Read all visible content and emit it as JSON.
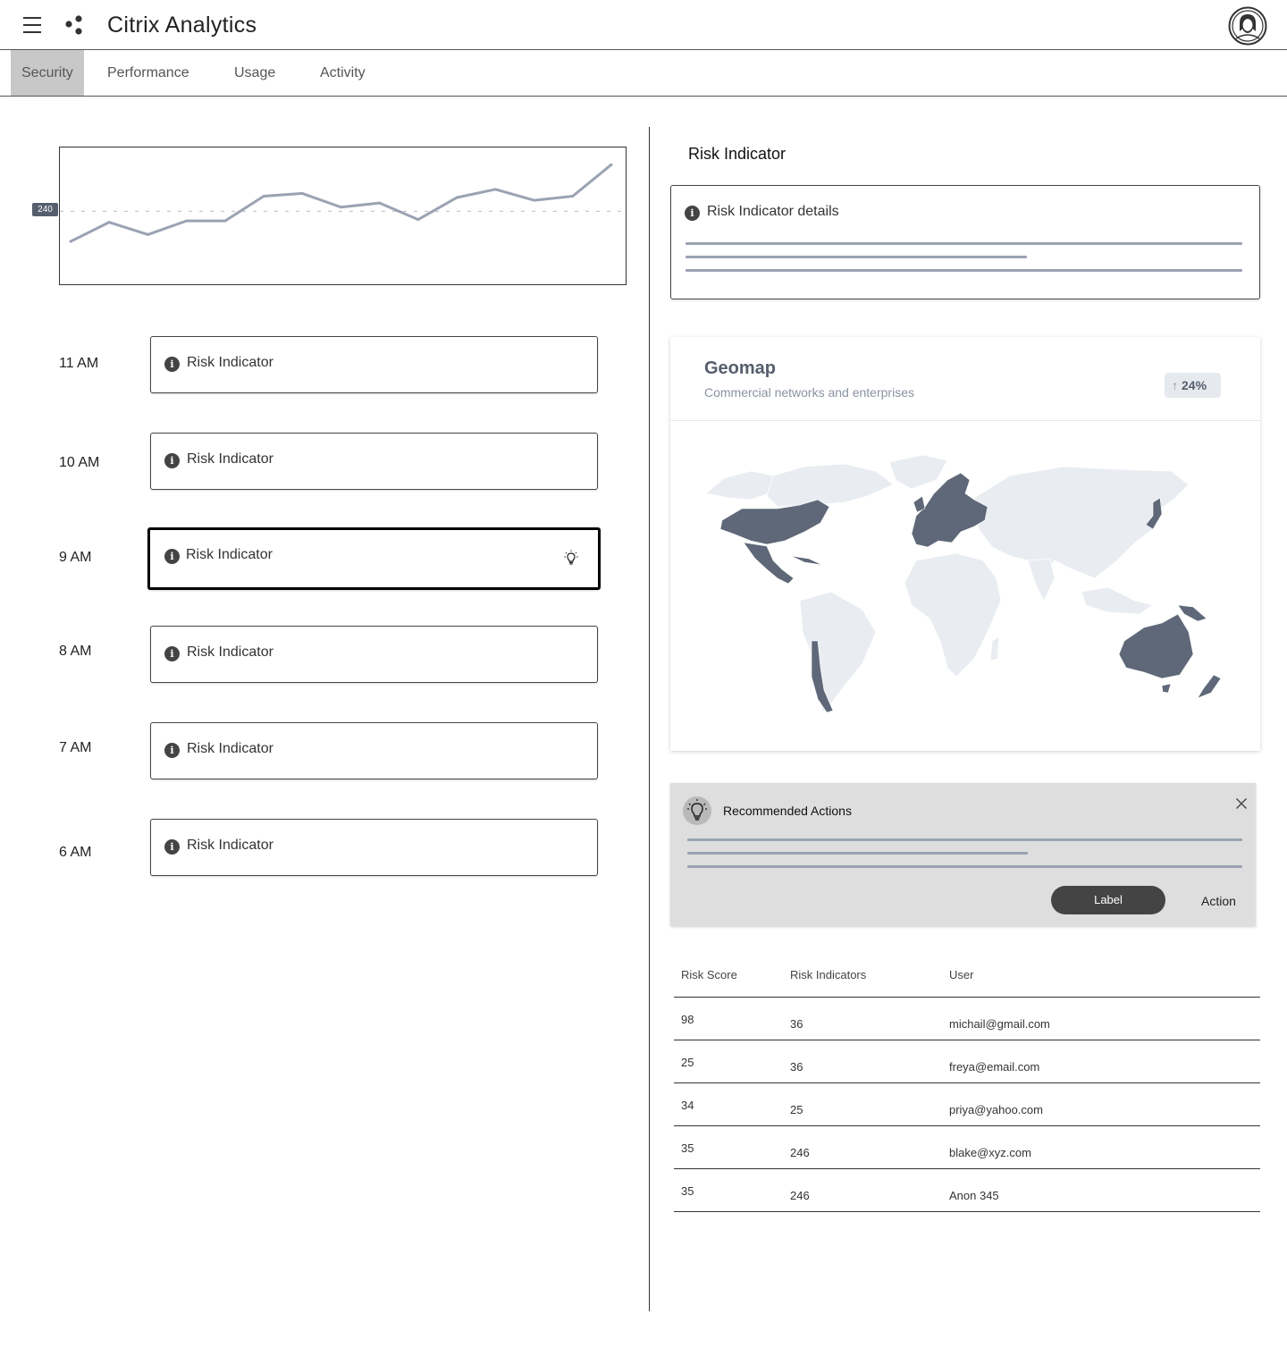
{
  "app": {
    "title": "Citrix Analytics"
  },
  "icons": {
    "menu": "hamburger-menu-icon",
    "logo": "citrix-dots-logo",
    "avatar": "user-avatar-icon",
    "info": "info-icon",
    "bulb": "lightbulb-icon",
    "close": "close-icon"
  },
  "tabs": [
    "Security",
    "Performance",
    "Usage",
    "Activity"
  ],
  "chart": {
    "reference_label": "240",
    "values": [
      130,
      200,
      155,
      205,
      205,
      295,
      305,
      255,
      270,
      210,
      290,
      320,
      280,
      295,
      410
    ]
  },
  "timeline": [
    {
      "time": "11 AM",
      "label": "Risk Indicator"
    },
    {
      "time": "10 AM",
      "label": "Risk Indicator"
    },
    {
      "time": "9 AM",
      "label": "Risk Indicator"
    },
    {
      "time": "8 AM",
      "label": "Risk Indicator"
    },
    {
      "time": "7 AM",
      "label": "Risk Indicator"
    },
    {
      "time": "6 AM",
      "label": "Risk Indicator"
    }
  ],
  "details": {
    "heading": "Risk Indicator",
    "card_label": "Risk Indicator details"
  },
  "geomap": {
    "title": "Geomap",
    "subtitle": "Commercial networks and enterprises",
    "change": "24%",
    "highlighted_regions": [
      "United States",
      "Mexico",
      "Central America",
      "Europe",
      "Japan",
      "Chile",
      "Australia",
      "New Zealand",
      "Papua New Guinea"
    ]
  },
  "recommended": {
    "title": "Recommended Actions",
    "button_label": "Label",
    "action_label": "Action"
  },
  "table": {
    "headers": [
      "Risk Score",
      "Risk Indicators",
      "User"
    ],
    "rows": [
      [
        "98",
        "36",
        "michail@gmail.com"
      ],
      [
        "25",
        "36",
        "freya@email.com"
      ],
      [
        "34",
        "25",
        "priya@yahoo.com"
      ],
      [
        "35",
        "246",
        "blake@xyz.com"
      ],
      [
        "35",
        "246",
        "Anon 345"
      ]
    ]
  },
  "colors": {
    "accent_dark": "#444444",
    "line_gray": "#9aa3b2",
    "map_highlight": "#5f6878",
    "map_base": "#e9ecf1"
  }
}
